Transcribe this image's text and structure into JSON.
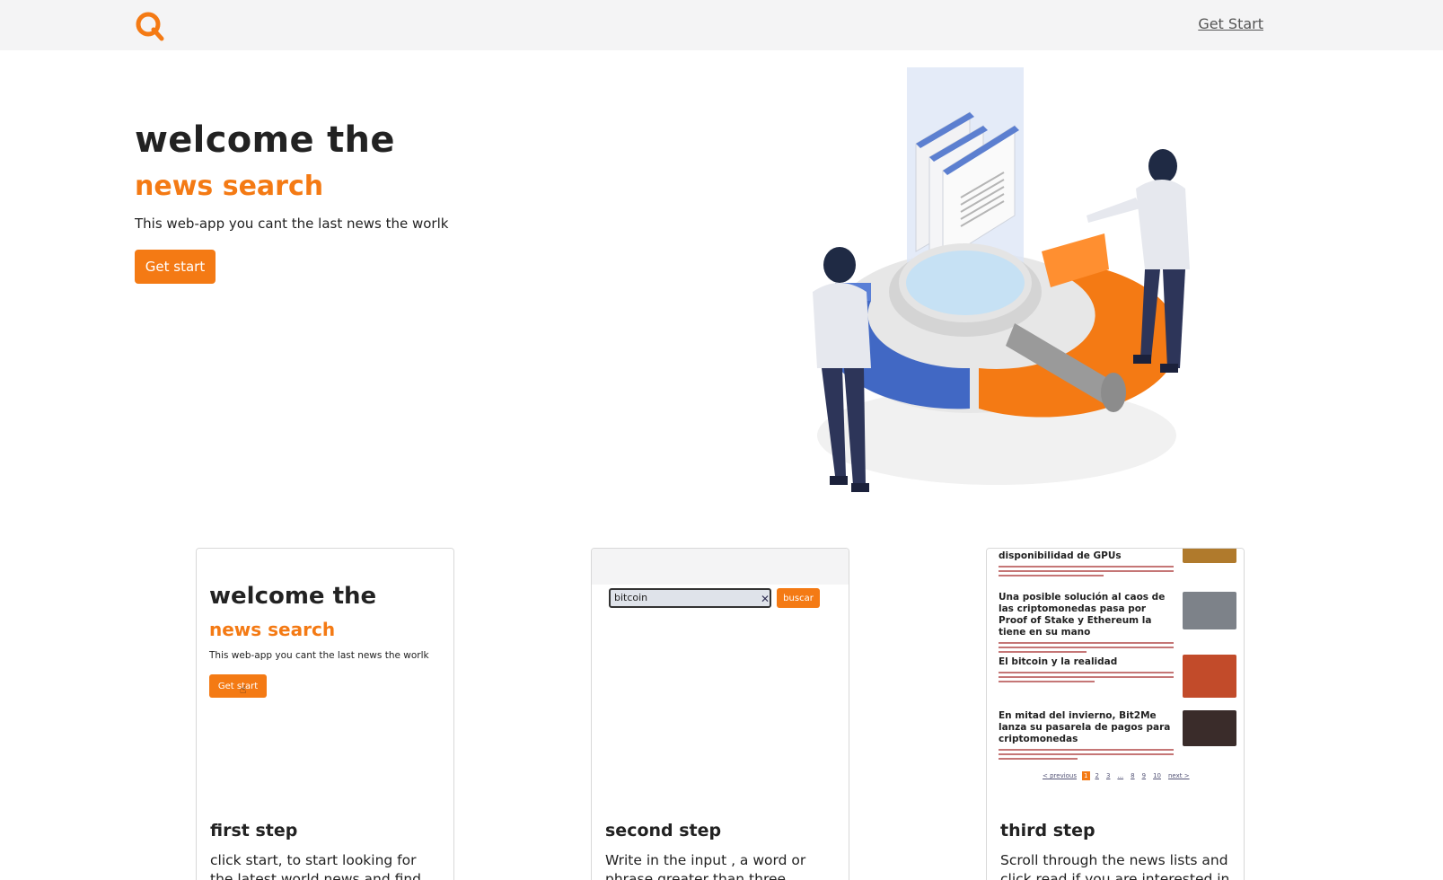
{
  "navbar": {
    "logo_name": "search-logo",
    "link_label": "Get Start"
  },
  "hero": {
    "title": "welcome the",
    "subtitle": "news search",
    "description": "This web-app you cant the last news the worlk",
    "button_label": "Get start"
  },
  "colors": {
    "accent": "#f47a14",
    "navbar_bg": "#f4f4f5",
    "text": "#222222"
  },
  "cards": [
    {
      "title": "first step",
      "text": "click start, to start looking for the latest world news and find out",
      "preview": {
        "title": "welcome the",
        "subtitle": "news search",
        "description": "This web-app you cant the last news the worlk",
        "button_label": "Get start"
      }
    },
    {
      "title": "second step",
      "text": "Write in the input , a word or phrase greater than three",
      "preview": {
        "input_value": "bitcoin",
        "button_label": "buscar",
        "clear_icon": "x-icon"
      }
    },
    {
      "title": "third step",
      "text": "Scroll through the news lists and click read if you are interested in",
      "preview": {
        "news": [
          {
            "title": "disponibilidad de GPUs"
          },
          {
            "title": "Una posible solución al caos de las criptomonedas pasa por Proof of Stake y Ethereum la tiene en su mano"
          },
          {
            "title": "El bitcoin y la realidad"
          },
          {
            "title": "En mitad del invierno, Bit2Me lanza su pasarela de pagos para criptomonedas"
          }
        ],
        "pagination": [
          "< previous",
          "1",
          "2",
          "3",
          "...",
          "8",
          "9",
          "10",
          "next >"
        ]
      }
    }
  ]
}
